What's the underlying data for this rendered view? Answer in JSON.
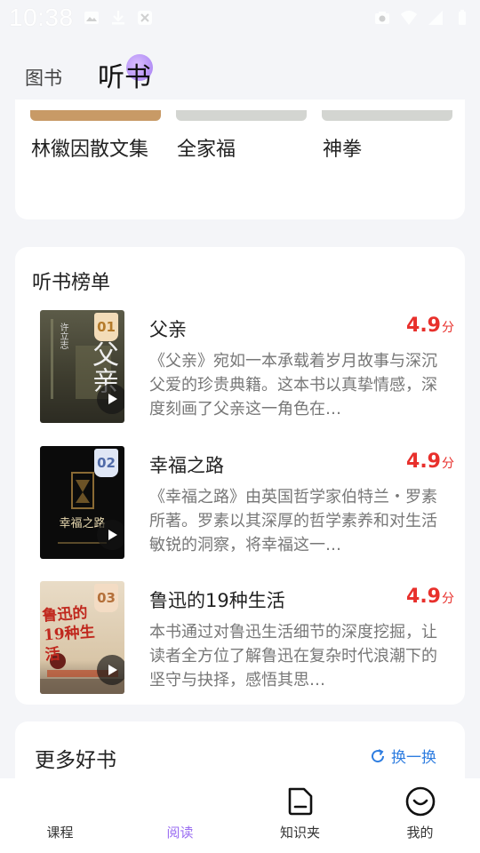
{
  "status_bar": {
    "time": "10:38"
  },
  "top_tabs": [
    {
      "label": "图书"
    },
    {
      "label": "听书"
    }
  ],
  "featured_books": [
    {
      "title": "林徽因散文集",
      "cover_color": "#c8a77a"
    },
    {
      "title": "全家福",
      "cover_color": "#d8dad6"
    },
    {
      "title": "神拳",
      "cover_color": "#d8dad6"
    }
  ],
  "ranking": {
    "title": "听书榜单",
    "items": [
      {
        "rank": "01",
        "title": "父亲",
        "score": "4.9",
        "score_unit": "分",
        "description": "《父亲》宛如一本承载着岁月故事与深沉父爱的珍贵典籍。这本书以真挚情感，深度刻画了父亲这一角色在…",
        "cover_text": "父亲",
        "cover_sub": "许立志",
        "cover_color": "#4a4a3a"
      },
      {
        "rank": "02",
        "title": "幸福之路",
        "score": "4.9",
        "score_unit": "分",
        "description": "《幸福之路》由英国哲学家伯特兰・罗素所著。罗素以其深厚的哲学素养和对生活敏锐的洞察，将幸福这一…",
        "cover_text": "幸福之路",
        "cover_color": "#0d0d0d"
      },
      {
        "rank": "03",
        "title": "鲁迅的19种生活",
        "score": "4.9",
        "score_unit": "分",
        "description": "本书通过对鲁迅生活细节的深度挖掘，让读者全方位了解鲁迅在复杂时代浪潮下的坚守与抉择，感悟其思…",
        "cover_text": "鲁迅的19种生活",
        "cover_color": "#e4d5bf"
      }
    ]
  },
  "more_books": {
    "title": "更多好书",
    "refresh_label": "换一换"
  },
  "bottom_nav": [
    {
      "label": "课程",
      "icon": "course-icon"
    },
    {
      "label": "阅读",
      "icon": "read-icon"
    },
    {
      "label": "知识夹",
      "icon": "folder-icon"
    },
    {
      "label": "我的",
      "icon": "smile-face-icon"
    }
  ],
  "colors": {
    "accent": "#9a6df2",
    "score": "#e8302c",
    "link": "#2e7de0"
  }
}
